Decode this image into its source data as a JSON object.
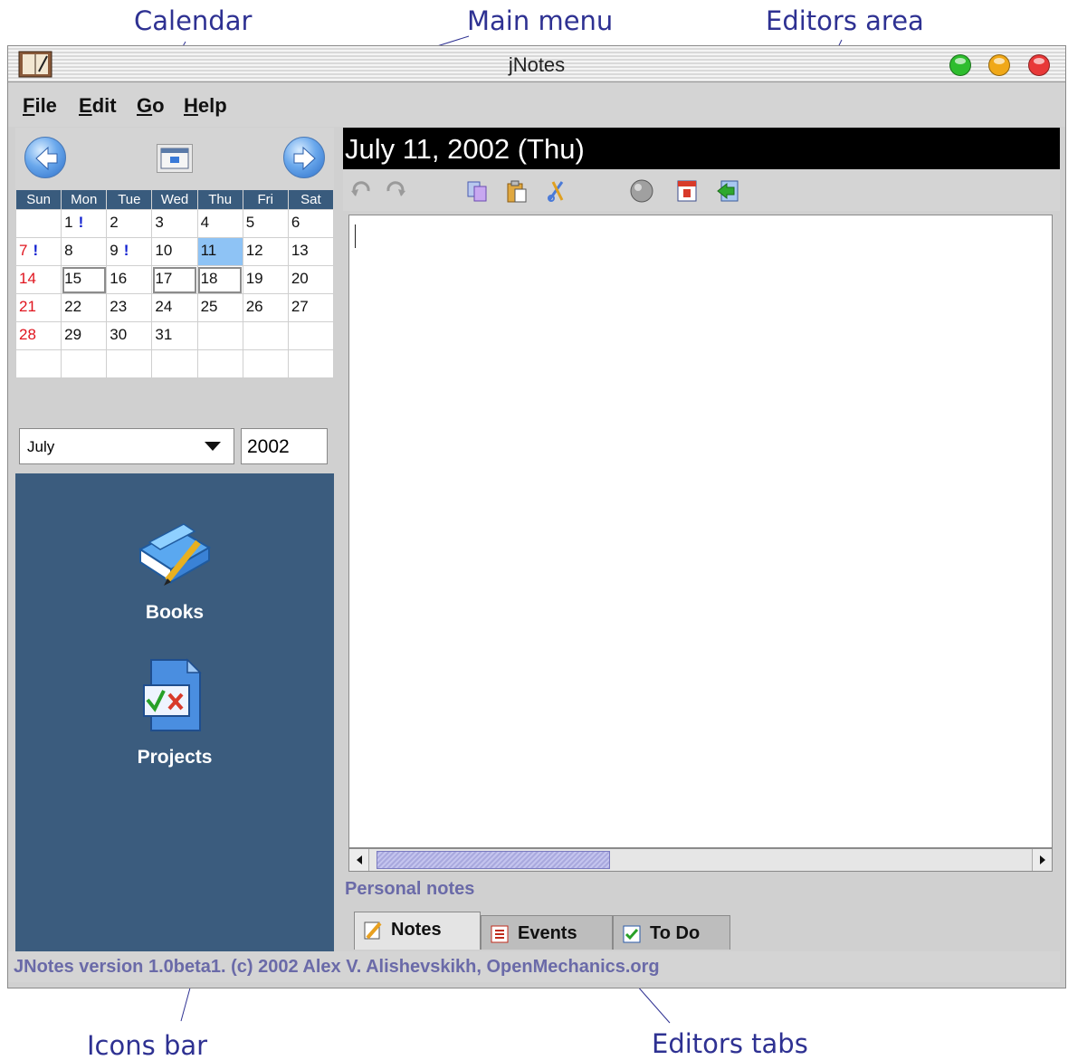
{
  "annotations": {
    "calendar": "Calendar",
    "main_menu": "Main menu",
    "editors_area": "Editors area",
    "icons_bar": "Icons bar",
    "editors_tabs": "Editors tabs"
  },
  "window": {
    "title": "jNotes"
  },
  "menu": {
    "file": {
      "ul": "F",
      "rest": "ile"
    },
    "edit": {
      "ul": "E",
      "rest": "dit"
    },
    "go": {
      "ul": "G",
      "rest": "o"
    },
    "help": {
      "ul": "H",
      "rest": "elp"
    }
  },
  "calendar": {
    "weekdays": [
      "Sun",
      "Mon",
      "Tue",
      "Wed",
      "Thu",
      "Fri",
      "Sat"
    ],
    "weeks": [
      [
        "",
        "1",
        "2",
        "3",
        "4",
        "5",
        "6"
      ],
      [
        "7",
        "8",
        "9",
        "10",
        "11",
        "12",
        "13"
      ],
      [
        "14",
        "15",
        "16",
        "17",
        "18",
        "19",
        "20"
      ],
      [
        "21",
        "22",
        "23",
        "24",
        "25",
        "26",
        "27"
      ],
      [
        "28",
        "29",
        "30",
        "31",
        "",
        "",
        ""
      ],
      [
        "",
        "",
        "",
        "",
        "",
        "",
        ""
      ]
    ],
    "mark_symbol": "!",
    "month": "July",
    "year": "2002"
  },
  "iconsbar": {
    "books_label": "Books",
    "projects_label": "Projects"
  },
  "editor": {
    "date_header": "July 11, 2002 (Thu)",
    "label": "Personal notes",
    "tabs": {
      "notes": "Notes",
      "events": "Events",
      "todo": "To Do"
    }
  },
  "status": {
    "text": "JNotes version 1.0beta1. (c) 2002 Alex V. Alishevskikh, OpenMechanics.org"
  },
  "colors": {
    "annotation": "#2e3192",
    "header_bg": "#000000",
    "weekday_header_bg": "#395b7d",
    "iconsbar_bg": "#3b5c7e",
    "today_bg": "#8ec3f5",
    "sunday_text": "#e0141e",
    "status_text": "#6a6aa8"
  }
}
